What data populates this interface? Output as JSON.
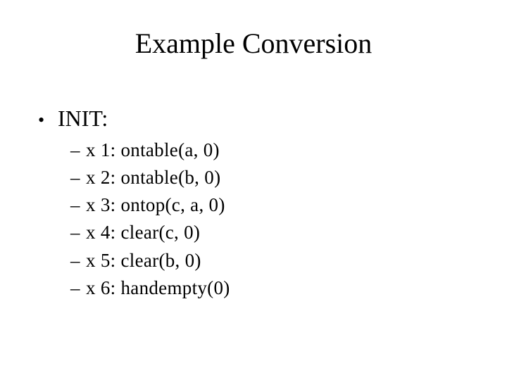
{
  "title": "Example Conversion",
  "bullets": {
    "l1_bullet_glyph": "•",
    "l2_bullet_glyph": "–",
    "items": [
      {
        "label": "INIT:",
        "sub": [
          "x 1: ontable(a, 0)",
          "x 2: ontable(b, 0)",
          "x 3: ontop(c, a, 0)",
          "x 4: clear(c, 0)",
          "x 5: clear(b, 0)",
          "x 6: handempty(0)"
        ]
      }
    ]
  }
}
